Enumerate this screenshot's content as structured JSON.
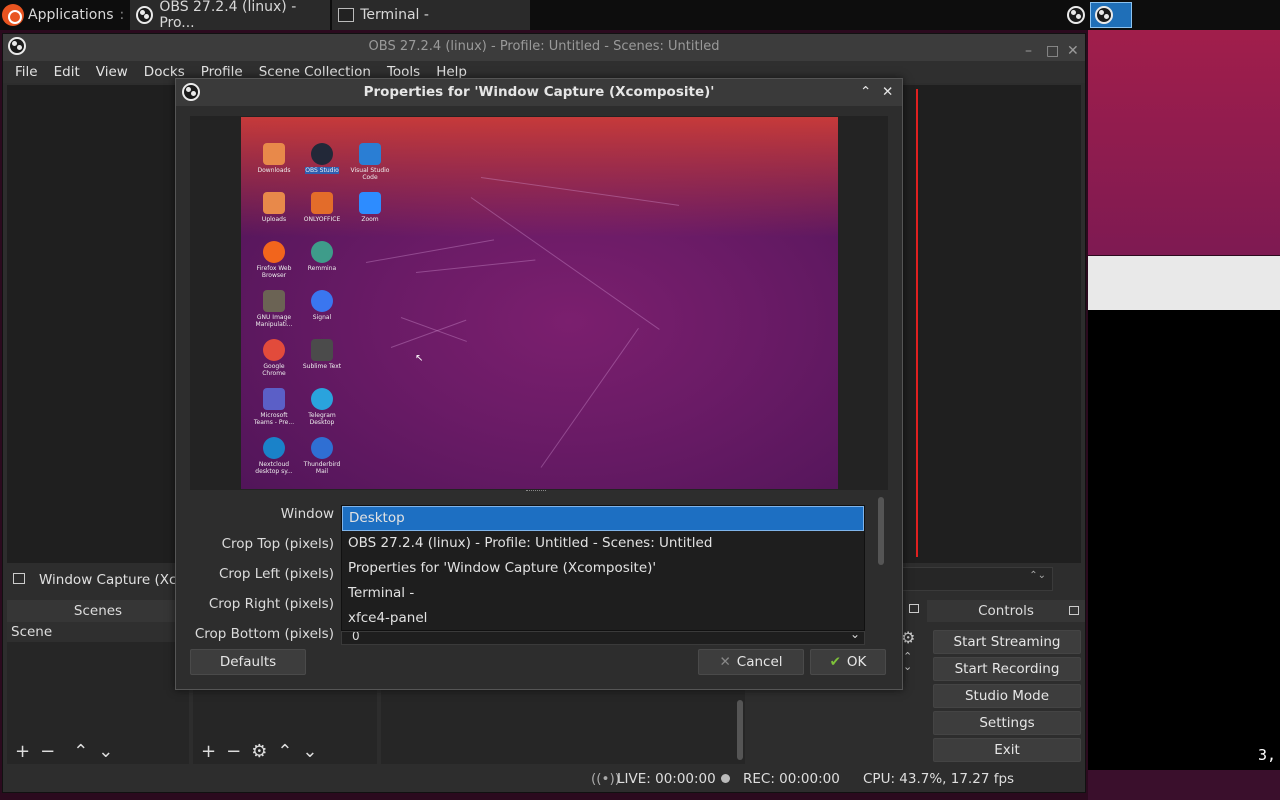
{
  "taskbar": {
    "applications_label": "Applications",
    "separator": ":",
    "tasks": [
      {
        "label": "OBS 27.2.4 (linux) - Pro..."
      },
      {
        "label": "Terminal -"
      }
    ]
  },
  "obs": {
    "title": "OBS 27.2.4 (linux) - Profile: Untitled - Scenes: Untitled",
    "menu": [
      "File",
      "Edit",
      "View",
      "Docks",
      "Profile",
      "Scene Collection",
      "Tools",
      "Help"
    ],
    "source_name": "Window Capture (Xco",
    "scenes_title": "Scenes",
    "scene_item": "Scene",
    "controls_title": "Controls",
    "controls": [
      "Start Streaming",
      "Start Recording",
      "Studio Mode",
      "Settings",
      "Exit"
    ],
    "status": {
      "live": "LIVE: 00:00:00",
      "rec": "REC: 00:00:00",
      "cpu": "CPU: 43.7%, 17.27 fps"
    }
  },
  "dialog": {
    "title": "Properties for 'Window Capture (Xcomposite)'",
    "labels": {
      "window": "Window",
      "crop_top": "Crop Top (pixels)",
      "crop_left": "Crop Left (pixels)",
      "crop_right": "Crop Right (pixels)",
      "crop_bottom": "Crop Bottom (pixels)"
    },
    "window_options": [
      "Desktop",
      "OBS 27.2.4 (linux) - Profile: Untitled - Scenes: Untitled",
      "Properties for 'Window Capture (Xcomposite)'",
      "Terminal -",
      "xfce4-panel"
    ],
    "crop_bottom_value": "0",
    "defaults_label": "Defaults",
    "cancel_label": "Cancel",
    "ok_label": "OK"
  },
  "desktop_icons": [
    {
      "label": "Downloads",
      "color": "#e8894a"
    },
    {
      "label": "OBS Studio",
      "color": "#222838"
    },
    {
      "label": "Visual Studio Code",
      "color": "#2a7ed4"
    },
    {
      "label": "Uploads",
      "color": "#e8894a"
    },
    {
      "label": "ONLYOFFICE",
      "color": "#e36c2a"
    },
    {
      "label": "Zoom",
      "color": "#2d8cff"
    },
    {
      "label": "Firefox Web Browser",
      "color": "#f2651c"
    },
    {
      "label": "Remmina",
      "color": "#3e9c8a"
    },
    {
      "label": "GNU Image Manipulati...",
      "color": "#6b6354"
    },
    {
      "label": "Signal",
      "color": "#3a76f0"
    },
    {
      "label": "Google Chrome",
      "color": "#e24b3b"
    },
    {
      "label": "Sublime Text",
      "color": "#4b4b4b"
    },
    {
      "label": "Microsoft Teams - Pre...",
      "color": "#5b5fc7"
    },
    {
      "label": "Telegram Desktop",
      "color": "#2aa3dd"
    },
    {
      "label": "Nextcloud desktop sy...",
      "color": "#1a82c9"
    },
    {
      "label": "Thunderbird Mail",
      "color": "#2f6fd3"
    }
  ],
  "terminal_bg_text": "3,",
  "colors": {
    "selection": "#1d6fc2",
    "record_frame": "#e02020",
    "ubuntu": "#e95420"
  }
}
